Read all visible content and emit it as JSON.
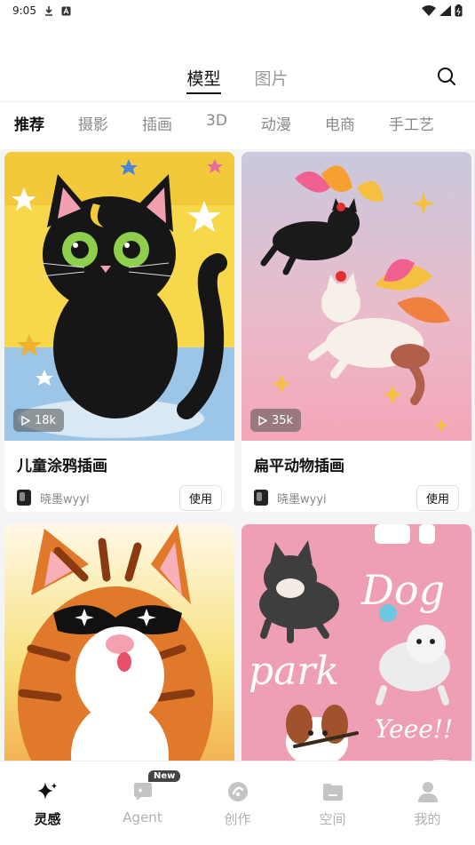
{
  "status_bar": {
    "time": "9:05"
  },
  "top_tabs": [
    {
      "label": "模型",
      "active": true
    },
    {
      "label": "图片",
      "active": false
    }
  ],
  "categories": [
    {
      "label": "推荐",
      "active": true
    },
    {
      "label": "摄影",
      "active": false
    },
    {
      "label": "插画",
      "active": false
    },
    {
      "label": "3D",
      "active": false
    },
    {
      "label": "动漫",
      "active": false
    },
    {
      "label": "电商",
      "active": false
    },
    {
      "label": "手工艺",
      "active": false
    }
  ],
  "cards": [
    {
      "title": "儿童涂鸦插画",
      "plays": "18k",
      "author": "晓墨wyyi",
      "button": "使用",
      "image": "black-cat-doodle"
    },
    {
      "title": "扁平动物插画",
      "plays": "35k",
      "author": "晓墨wyyi",
      "button": "使用",
      "image": "flying-cats-illustration"
    },
    {
      "title": "",
      "plays": "",
      "author": "",
      "button": "",
      "image": "pixel-tabby-cat"
    },
    {
      "title": "",
      "plays": "",
      "author": "",
      "button": "",
      "image": "dog-park-illustration"
    }
  ],
  "card_images_text": {
    "dog_park_word1": "Dog",
    "dog_park_word2": "park",
    "dog_park_word3": "Yeee!!"
  },
  "bottom_nav": [
    {
      "label": "灵感",
      "icon": "sparkle-icon",
      "active": true
    },
    {
      "label": "Agent",
      "icon": "agent-chat-icon",
      "active": false,
      "badge": "New"
    },
    {
      "label": "创作",
      "icon": "create-icon",
      "active": false
    },
    {
      "label": "空间",
      "icon": "folder-icon",
      "active": false
    },
    {
      "label": "我的",
      "icon": "profile-icon",
      "active": false
    }
  ],
  "colors": {
    "accent": "#111111",
    "inactive": "#b0b0b0",
    "feed_bg": "#f4f4f4"
  }
}
